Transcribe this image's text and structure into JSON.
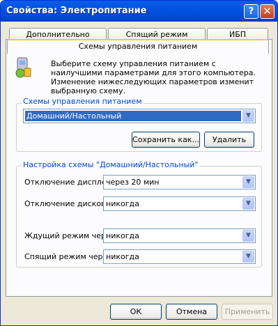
{
  "window": {
    "title": "Свойства: Электропитание",
    "help": "?",
    "close": "✕"
  },
  "tabs": [
    "Дополнительно",
    "Спящий режим",
    "ИБП",
    "Схемы управления питанием"
  ],
  "intro": "Выберите схему управления питанием с наилучшими параметрами для этого компьютера. Изменение нижеследующих параметров изменит выбранную схему.",
  "schemes": {
    "legend": "Схемы управления питанием",
    "selected": "Домашний/Настольный",
    "save_label": "Сохранить как...",
    "delete_label": "Удалить"
  },
  "settings": {
    "legend": "Настройка схемы \"Домашний/Настольный\"",
    "display_label": "Отключение дисплея:",
    "display_value": "через 20 мин",
    "disks_label": "Отключение дисков:",
    "disks_value": "никогда",
    "standby_label": "Ждущий режим через:",
    "standby_value": "никогда",
    "hibernate_label": "Спящий режим через:",
    "hibernate_value": "никогда"
  },
  "footer": {
    "ok": "ОК",
    "cancel": "Отмена",
    "apply": "Применить"
  },
  "icons": {
    "dropdown": "▼"
  },
  "colors": {
    "titlebar": "#0054e3",
    "accent": "#0046d5",
    "selection": "#316ac5",
    "tab_highlight": "#ffc73c"
  }
}
